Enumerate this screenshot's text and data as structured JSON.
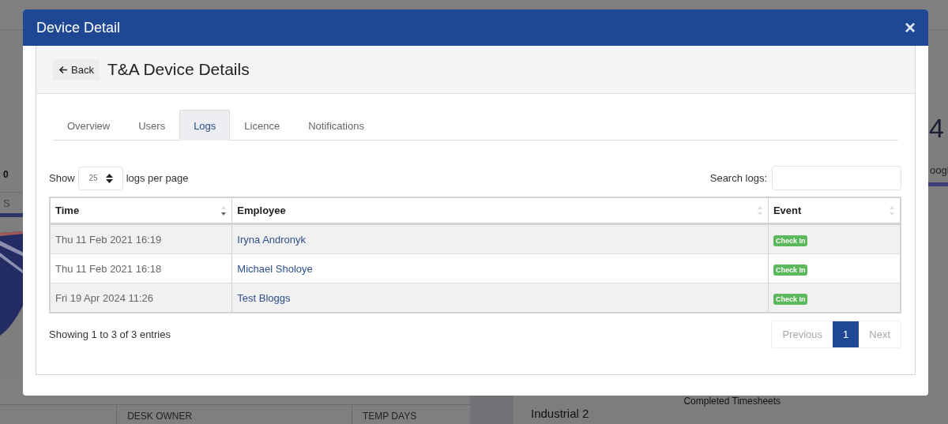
{
  "background_page": {
    "left_stat": "0",
    "left_tab": "S",
    "right_stat": "4",
    "right_label": "oogl",
    "table_headers": [
      "DESK OWNER",
      "TEMP DAYS"
    ],
    "panel_item": "Industrial 2",
    "side_label": "Completed Timesheets"
  },
  "modal": {
    "title": "Device Detail",
    "close": "×",
    "back_button": "Back",
    "heading": "T&A Device Details",
    "tabs": [
      {
        "label": "Overview",
        "selected": false
      },
      {
        "label": "Users",
        "selected": false
      },
      {
        "label": "Logs",
        "selected": true
      },
      {
        "label": "Licence",
        "selected": false
      },
      {
        "label": "Notifications",
        "selected": false
      }
    ],
    "length": {
      "before": "Show",
      "value": "25",
      "after": "logs per page"
    },
    "search": {
      "label": "Search logs:"
    },
    "table": {
      "columns": [
        {
          "label": "Time",
          "sorted_desc": true
        },
        {
          "label": "Employee",
          "sorted_desc": false
        },
        {
          "label": "Event",
          "sorted_desc": false
        }
      ],
      "rows": [
        {
          "time": "Thu 11 Feb 2021 16:19",
          "employee": "Iryna Andronyk",
          "event": "Check In"
        },
        {
          "time": "Thu 11 Feb 2021 16:18",
          "employee": "Michael Sholoye",
          "event": "Check In"
        },
        {
          "time": "Fri 19 Apr 2024 11:26",
          "employee": "Test Bloggs",
          "event": "Check In"
        }
      ]
    },
    "info": "Showing 1 to 3 of 3 entries",
    "pagination": [
      {
        "label": "Previous",
        "selected": false,
        "disabled": true
      },
      {
        "label": "1",
        "selected": true,
        "disabled": false
      },
      {
        "label": "Next",
        "selected": false,
        "disabled": true
      }
    ]
  }
}
